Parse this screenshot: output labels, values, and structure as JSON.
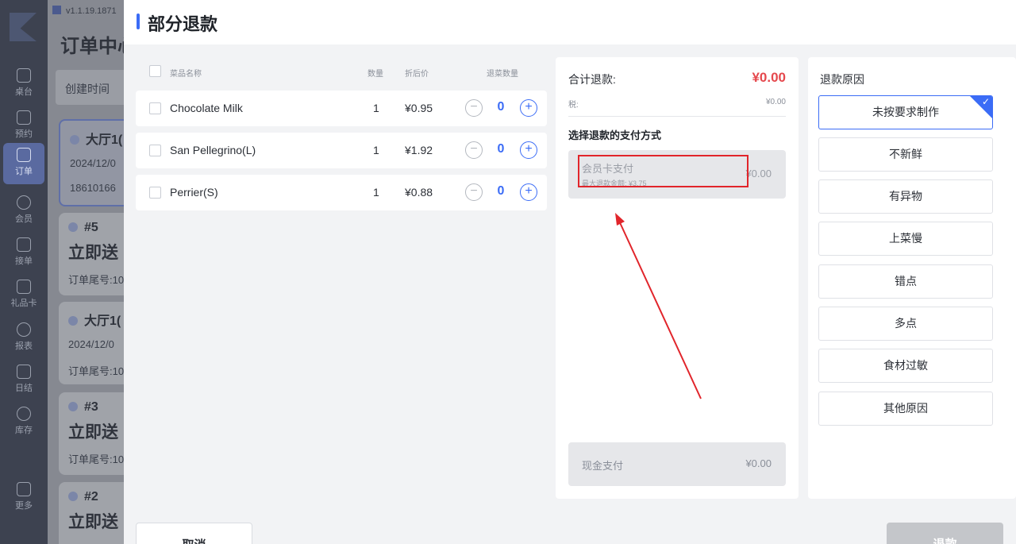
{
  "background": {
    "version": "v1.1.19.1871",
    "page_title": "订单中心",
    "filter_label": "创建时间",
    "nav": [
      {
        "label": "桌台",
        "icon": "table-icon"
      },
      {
        "label": "预约",
        "icon": "reservation-icon"
      },
      {
        "label": "订单",
        "icon": "order-icon"
      },
      {
        "label": "会员",
        "icon": "member-icon"
      },
      {
        "label": "接单",
        "icon": "accept-order-icon"
      },
      {
        "label": "礼品卡",
        "icon": "gift-card-icon"
      },
      {
        "label": "报表",
        "icon": "report-icon"
      },
      {
        "label": "日结",
        "icon": "daily-settlement-icon"
      },
      {
        "label": "库存",
        "icon": "inventory-icon"
      },
      {
        "label": "更多",
        "icon": "more-icon"
      }
    ],
    "orders": [
      {
        "line1": "大厅1(",
        "line2": "2024/12/0",
        "line3": "18610166"
      },
      {
        "line1": "#5",
        "line2": "立即送",
        "line3": "订单尾号:10"
      },
      {
        "line1": "大厅1(",
        "line2": "2024/12/0",
        "line3": "订单尾号:10"
      },
      {
        "line1": "#3",
        "line2": "立即送",
        "line3": "订单尾号:10"
      },
      {
        "line1": "#2",
        "line2": "立即送",
        "line3": ""
      }
    ]
  },
  "modal": {
    "title": "部分退款",
    "columns": {
      "name": "菜品名称",
      "qty": "数量",
      "price": "折后价",
      "refund_qty": "退菜数量"
    },
    "items": [
      {
        "name": "Chocolate Milk",
        "qty": "1",
        "price": "¥0.95",
        "refund_qty": "0"
      },
      {
        "name": "San Pellegrino(L)",
        "qty": "1",
        "price": "¥1.92",
        "refund_qty": "0"
      },
      {
        "name": "Perrier(S)",
        "qty": "1",
        "price": "¥0.88",
        "refund_qty": "0"
      }
    ],
    "summary": {
      "total_label": "合计退款:",
      "total_value": "¥0.00",
      "tax_label": "税:",
      "tax_value": "¥0.00",
      "method_title": "选择退款的支付方式",
      "member_card": {
        "name": "会员卡支付",
        "max_refund": "最大退款金额: ¥3.75",
        "amount": "¥0.00"
      },
      "cash": {
        "name": "现金支付",
        "amount": "¥0.00"
      }
    },
    "reasons": {
      "title": "退款原因",
      "options": [
        "未按要求制作",
        "不新鲜",
        "有异物",
        "上菜慢",
        "错点",
        "多点",
        "食材过敏",
        "其他原因"
      ],
      "selected_index": 0
    },
    "footer": {
      "cancel": "取消",
      "confirm": "退款"
    }
  },
  "colors": {
    "accent": "#3b6cf6",
    "total_red": "#e5484d",
    "annotation_red": "#e1252b"
  }
}
